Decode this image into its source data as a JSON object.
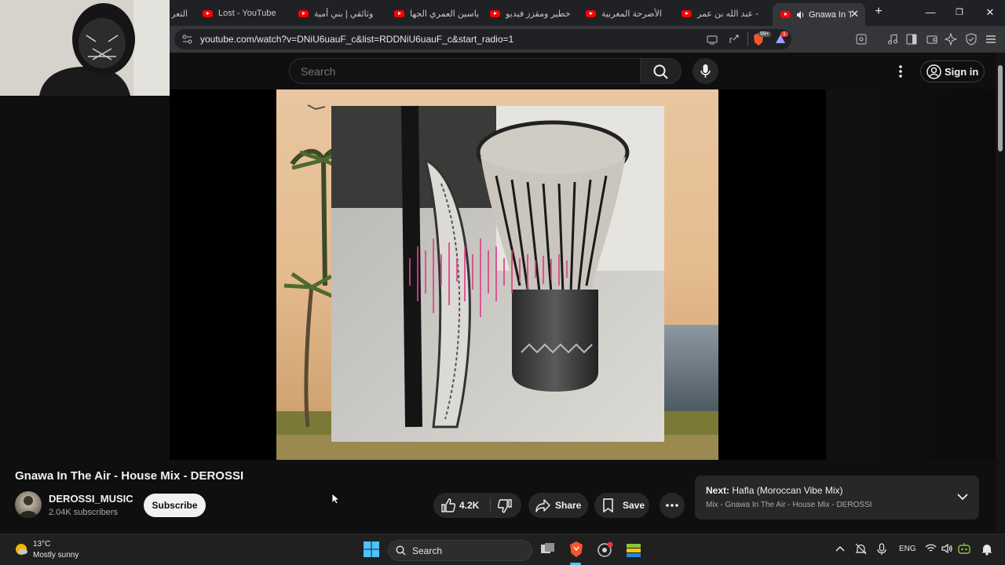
{
  "browser": {
    "tabs": [
      {
        "title": "التعر"
      },
      {
        "title": "Lost - YouTube"
      },
      {
        "title": "وثائقي | بني أمية"
      },
      {
        "title": "ياسين العمري الجها"
      },
      {
        "title": "خطير ومقزز فيديو"
      },
      {
        "title": "الأضرحة المغربية"
      },
      {
        "title": "عبد الله بن عمر - "
      },
      {
        "title": "Gnawa In T",
        "active": true
      }
    ],
    "url": "youtube.com/watch?v=DNiU6uauF_c&list=RDDNiU6uauF_c&start_radio=1",
    "brave_badge": "99+",
    "rewards_badge": "1"
  },
  "youtube": {
    "search_placeholder": "Search",
    "sign_in": "Sign in",
    "video_title": "Gnawa In The Air - House Mix - DEROSSI",
    "channel_name": "DEROSSI_MUSIC",
    "subscribers": "2.04K subscribers",
    "subscribe": "Subscribe",
    "likes": "4.2K",
    "share": "Share",
    "save": "Save",
    "next_label": "Next:",
    "next_title": "Hafla (Moroccan Vibe Mix)",
    "next_sub": "Mix - Gnawa In The Air - House Mix - DEROSSI"
  },
  "taskbar": {
    "temperature": "13°C",
    "weather": "Mostly sunny",
    "search": "Search",
    "language": "ENG"
  },
  "colors": {
    "accent_red": "#ff0000",
    "background": "#0f0f0f",
    "pill": "#272727"
  }
}
